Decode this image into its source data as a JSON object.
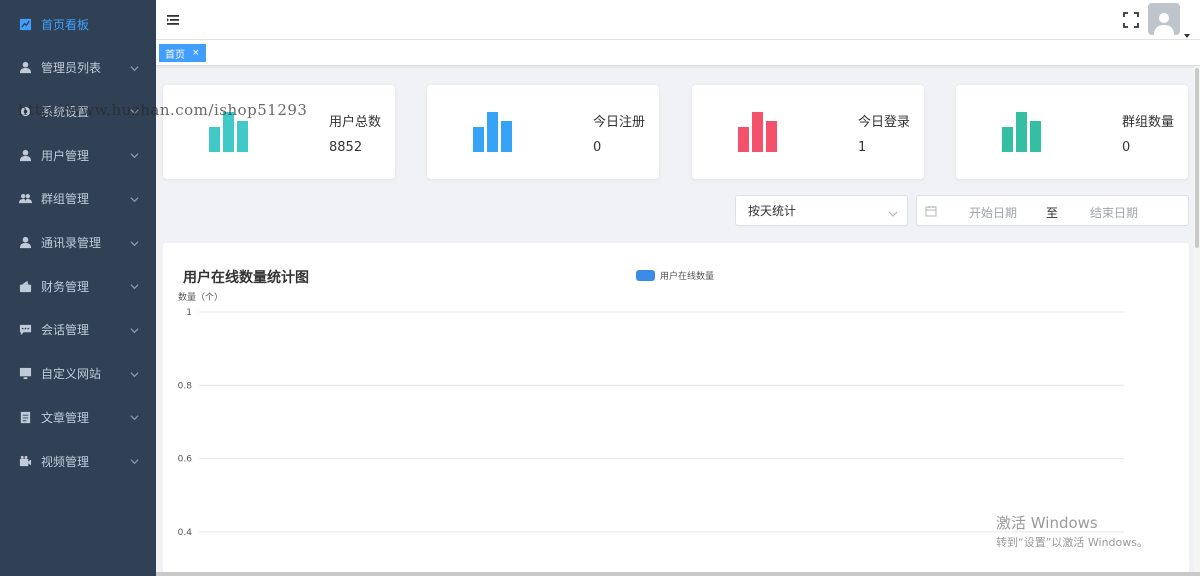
{
  "sidebar": {
    "items": [
      {
        "label": "首页看板",
        "icon": "trend-chart-icon",
        "active": true,
        "has_children": false
      },
      {
        "label": "管理员列表",
        "icon": "user-icon",
        "active": false,
        "has_children": true
      },
      {
        "label": "系统设置",
        "icon": "settings-icon",
        "active": false,
        "has_children": true
      },
      {
        "label": "用户管理",
        "icon": "user-icon",
        "active": false,
        "has_children": true
      },
      {
        "label": "群组管理",
        "icon": "group-icon",
        "active": false,
        "has_children": true
      },
      {
        "label": "通讯录管理",
        "icon": "user-icon",
        "active": false,
        "has_children": true
      },
      {
        "label": "财务管理",
        "icon": "wallet-icon",
        "active": false,
        "has_children": true
      },
      {
        "label": "会话管理",
        "icon": "chat-icon",
        "active": false,
        "has_children": true
      },
      {
        "label": "自定义网站",
        "icon": "monitor-icon",
        "active": false,
        "has_children": true
      },
      {
        "label": "文章管理",
        "icon": "document-icon",
        "active": false,
        "has_children": true
      },
      {
        "label": "视频管理",
        "icon": "video-icon",
        "active": false,
        "has_children": true
      }
    ]
  },
  "overlay_watermark": "http://www.huzhan.com/ishop51293",
  "tags": [
    {
      "label": "首页",
      "close": "×"
    }
  ],
  "stats": [
    {
      "label": "用户总数",
      "value": "8852",
      "color": "#40c9c6"
    },
    {
      "label": "今日注册",
      "value": "0",
      "color": "#36a3f7"
    },
    {
      "label": "今日登录",
      "value": "1",
      "color": "#f4516c"
    },
    {
      "label": "群组数量",
      "value": "0",
      "color": "#34bfa3"
    }
  ],
  "filters": {
    "group_by": "按天统计",
    "start_placeholder": "开始日期",
    "separator": "至",
    "end_placeholder": "结束日期"
  },
  "chart_data": {
    "type": "line",
    "title": "用户在线数量统计图",
    "ylabel": "数量（个）",
    "series": [
      {
        "name": "用户在线数量",
        "color": "#3c8ce7",
        "values": []
      }
    ],
    "yticks": [
      "1",
      "0.8",
      "0.6",
      "0.4"
    ],
    "grid": true,
    "legend": "top-center"
  },
  "windows_watermark": {
    "line1": "激活 Windows",
    "line2": "转到“设置”以激活 Windows。"
  }
}
